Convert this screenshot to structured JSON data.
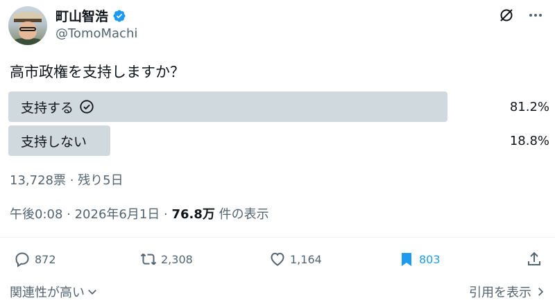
{
  "author": {
    "display_name": "町山智浩",
    "handle": "@TomoMachi"
  },
  "post": {
    "question": "高市政権を支持しますか？"
  },
  "poll": {
    "options": [
      {
        "label": "支持する",
        "percent_text": "81.2%",
        "percent": 81.2,
        "selected": true
      },
      {
        "label": "支持しない",
        "percent_text": "18.8%",
        "percent": 18.8,
        "selected": false
      }
    ],
    "votes_text": "13,728票 · 残り5日"
  },
  "meta": {
    "timestamp": "午後0:08 · 2026年6月1日 · ",
    "views": "76.8万",
    "views_suffix": " 件の表示"
  },
  "actions": {
    "replies": "872",
    "reposts": "2,308",
    "likes": "1,164",
    "bookmarks": "803"
  },
  "footer": {
    "sort_label": "関連性が高い",
    "quotes_label": "引用を表示"
  },
  "colors": {
    "poll_bar": "#cfd9de",
    "accent": "#1d9bf0",
    "muted_text": "#536471"
  }
}
